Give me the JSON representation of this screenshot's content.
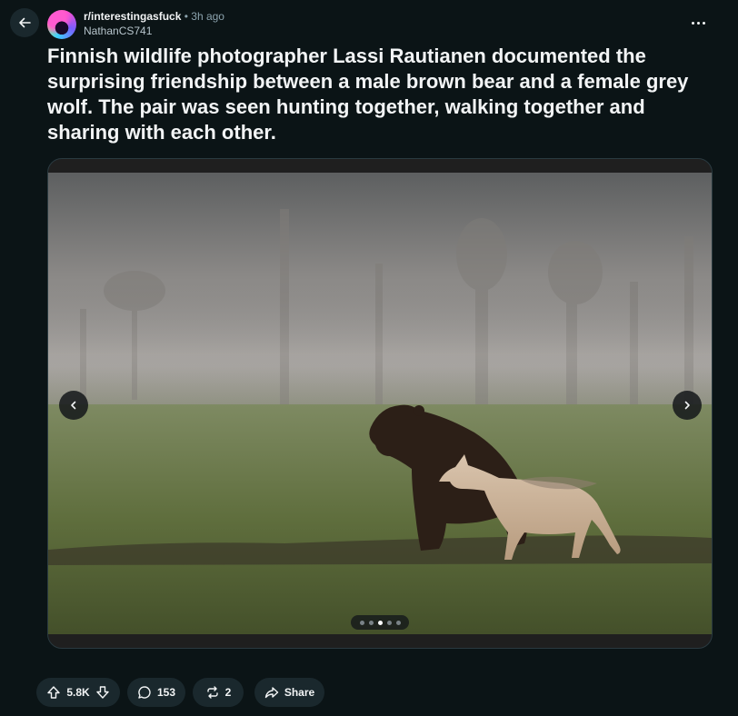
{
  "post": {
    "subreddit": "r/interestingasfuck",
    "separator": "•",
    "time_ago": "3h ago",
    "author": "NathanCS741",
    "title": "Finnish wildlife photographer Lassi Rautianen documented the surprising friendship between a male brown bear and a female grey wolf. The pair was seen hunting together, walking together and sharing with each other."
  },
  "gallery": {
    "image_count": 5,
    "active_index": 2
  },
  "actions": {
    "votes": "5.8K",
    "comments": "153",
    "crossposts": "2",
    "share_label": "Share"
  },
  "icons": {
    "back": "arrow-left-icon",
    "more": "more-horizontal-icon",
    "upvote": "upvote-icon",
    "downvote": "downvote-icon",
    "comment": "comment-icon",
    "crosspost": "crosspost-icon",
    "share": "share-icon"
  }
}
